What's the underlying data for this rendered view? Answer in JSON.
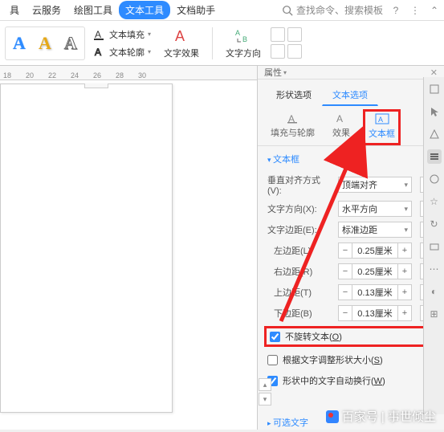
{
  "menu": {
    "items": [
      "具",
      "云服务",
      "绘图工具",
      "文本工具",
      "文档助手"
    ],
    "active_index": 3,
    "search": "查找命令、搜索模板"
  },
  "ribbon": {
    "fill": "文本填充",
    "outline": "文本轮廓",
    "effect": "文字效果",
    "direction": "文字方向"
  },
  "ruler": [
    "18",
    "20",
    "22",
    "24",
    "26",
    "28",
    "30"
  ],
  "panel": {
    "title": "属性",
    "tabs1": [
      "形状选项",
      "文本选项"
    ],
    "tabs1_active": 1,
    "tabs2": [
      {
        "label": "填充与轮廓"
      },
      {
        "label": "效果"
      },
      {
        "label": "文本框"
      }
    ],
    "tabs2_active": 2,
    "section_textbox": "文本框",
    "valign_label": "垂直对齐方式(V):",
    "valign_value": "顶端对齐",
    "textdir_label": "文字方向(X):",
    "textdir_value": "水平方向",
    "margin_label": "文字边距(E):",
    "margin_value": "标准边距",
    "left_label": "左边距(L)",
    "left_value": "0.25厘米",
    "right_label": "右边距(R)",
    "right_value": "0.25厘米",
    "top_label": "上边距(T)",
    "top_value": "0.13厘米",
    "bottom_label": "下边距(B)",
    "bottom_value": "0.13厘米",
    "chk_norotate": {
      "label_pre": "不旋转文本(",
      "key": "O",
      "label_post": ")",
      "checked": true
    },
    "chk_autosize": {
      "label_pre": "根据文字调整形状大小(",
      "key": "S",
      "label_post": ")",
      "checked": false
    },
    "chk_wrap": {
      "label_pre": "形状中的文字自动换行(",
      "key": "W",
      "label_post": ")",
      "checked": true
    },
    "section_optional": "可选文字"
  },
  "watermark": "百家号 | 事世倾尘"
}
